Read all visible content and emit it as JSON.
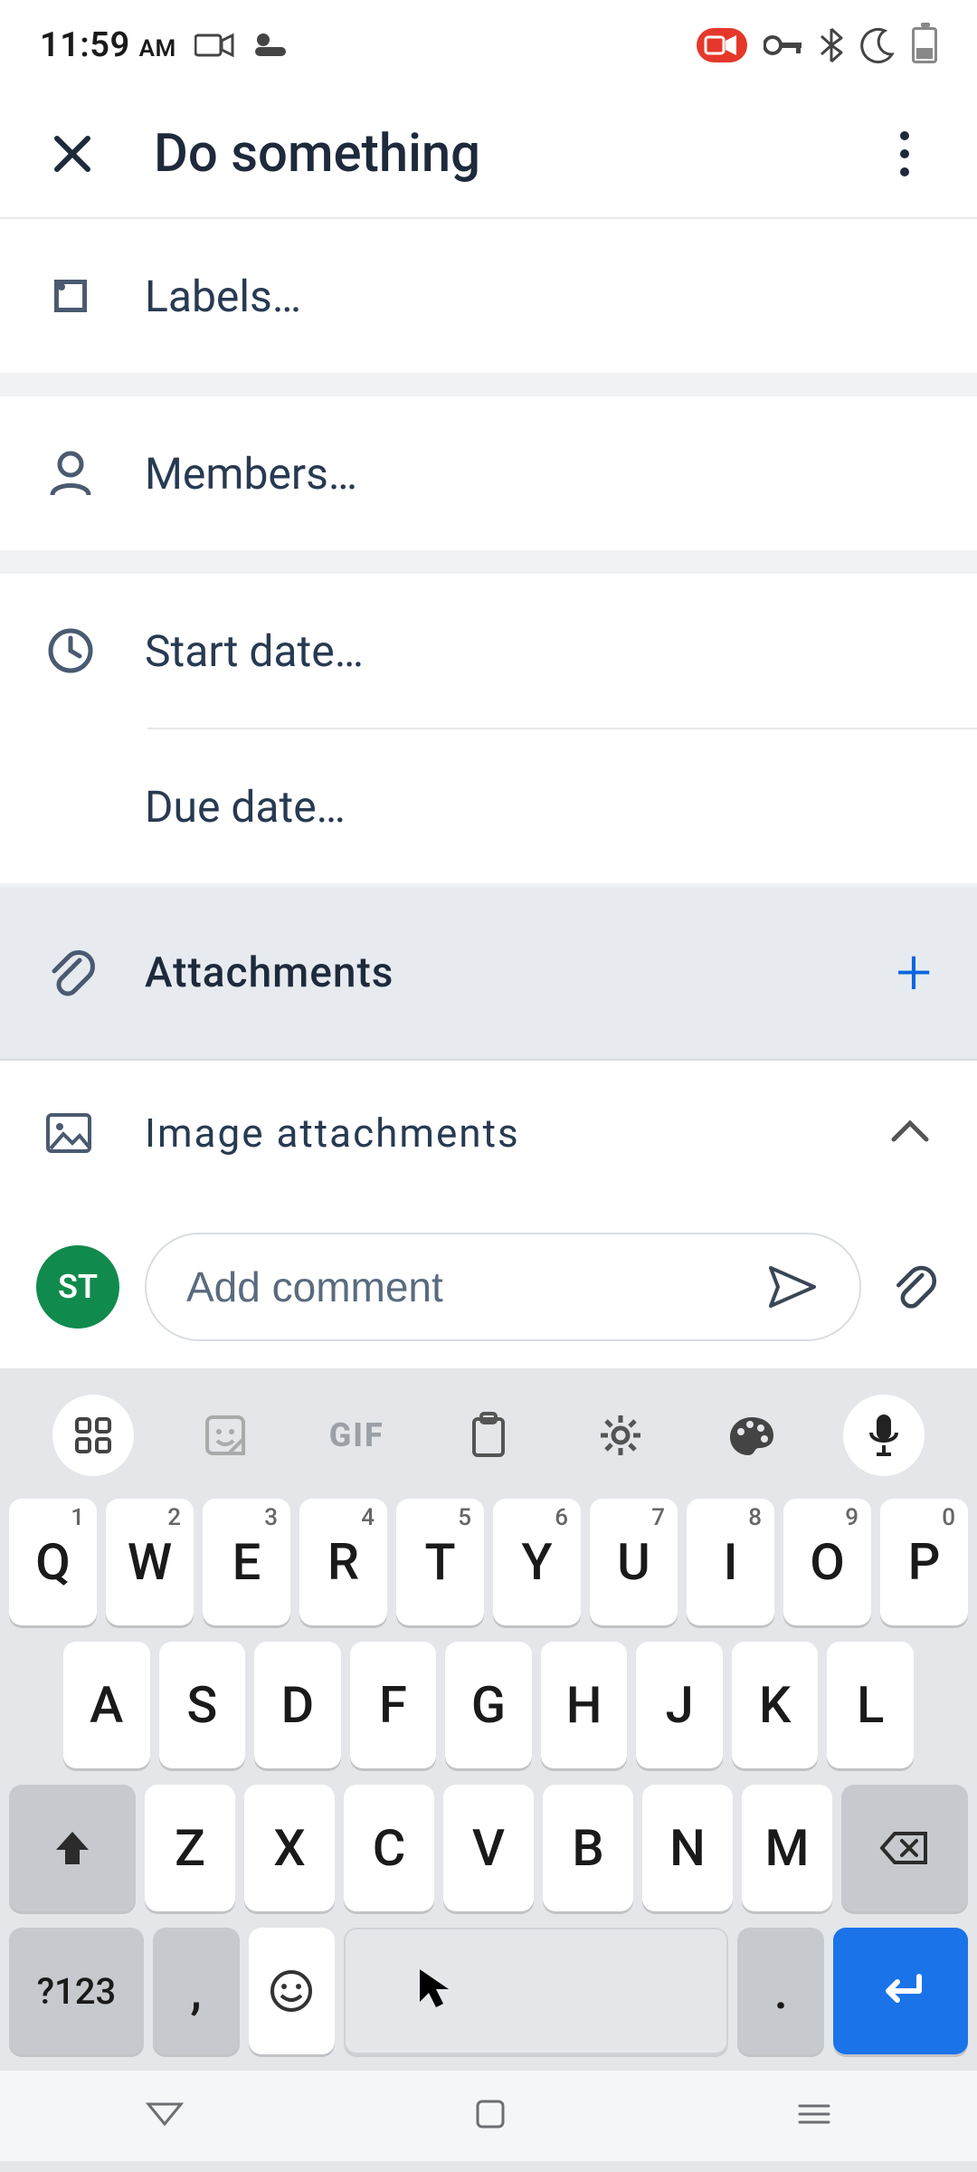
{
  "status": {
    "time": "11:59",
    "ampm": "AM"
  },
  "header": {
    "title": "Do something"
  },
  "rows": {
    "labels": "Labels…",
    "members": "Members…",
    "start_date": "Start date…",
    "due_date": "Due date…",
    "attachments": "Attachments",
    "image_attachments": "Image attachments"
  },
  "comment": {
    "avatar_initials": "ST",
    "placeholder": "Add comment"
  },
  "keyboard": {
    "gif_label": "GIF",
    "row1": [
      {
        "k": "Q",
        "s": "1"
      },
      {
        "k": "W",
        "s": "2"
      },
      {
        "k": "E",
        "s": "3"
      },
      {
        "k": "R",
        "s": "4"
      },
      {
        "k": "T",
        "s": "5"
      },
      {
        "k": "Y",
        "s": "6"
      },
      {
        "k": "U",
        "s": "7"
      },
      {
        "k": "I",
        "s": "8"
      },
      {
        "k": "O",
        "s": "9"
      },
      {
        "k": "P",
        "s": "0"
      }
    ],
    "row2": [
      "A",
      "S",
      "D",
      "F",
      "G",
      "H",
      "J",
      "K",
      "L"
    ],
    "row3": [
      "Z",
      "X",
      "C",
      "V",
      "B",
      "N",
      "M"
    ],
    "sym": "?123",
    "comma": ",",
    "period": "."
  }
}
